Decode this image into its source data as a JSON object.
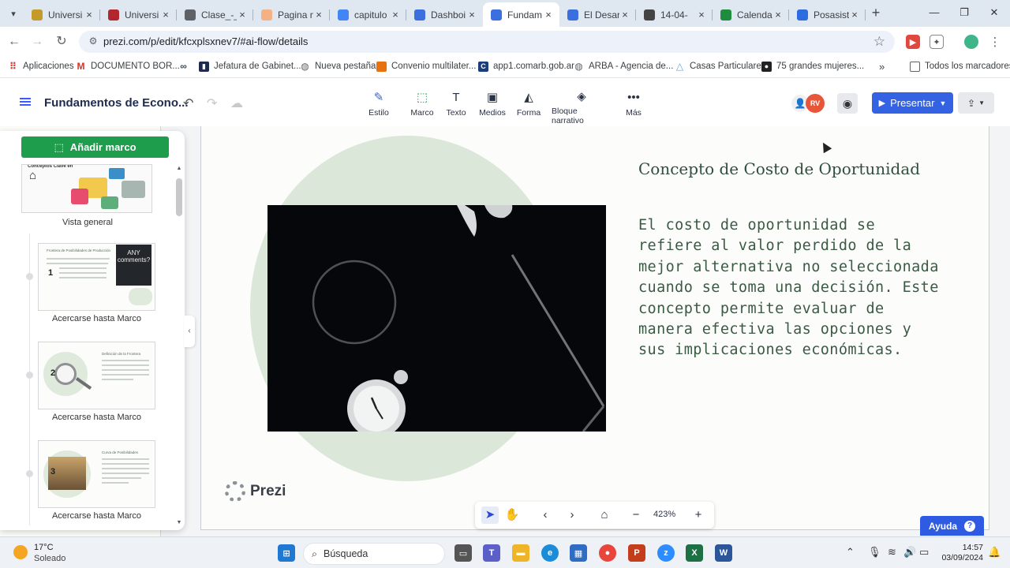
{
  "browser": {
    "tabs": [
      {
        "title": "Universi",
        "icon_color": "#c49a2b"
      },
      {
        "title": "Universi",
        "icon_color": "#b3262e"
      },
      {
        "title": "Clase_-_",
        "icon_color": "#5f6368"
      },
      {
        "title": "Pagina n",
        "icon_color": "#f4b183"
      },
      {
        "title": "capitulo",
        "icon_color": "#4285f4"
      },
      {
        "title": "Dashboi",
        "icon_color": "#3b6fe0"
      },
      {
        "title": "Fundam",
        "icon_color": "#3b6fe0"
      },
      {
        "title": "El Desar",
        "icon_color": "#3b6fe0"
      },
      {
        "title": "14-04-",
        "icon_color": "#444444"
      },
      {
        "title": "Calenda",
        "icon_color": "#1e8e3e"
      },
      {
        "title": "Posasist",
        "icon_color": "#2d6ce0"
      }
    ],
    "active_tab_index": 6,
    "url": "prezi.com/p/edit/kfcxplsxnev7/#ai-flow/details",
    "bookmarks": [
      {
        "label": "Aplicaciones",
        "color": "#e8453c"
      },
      {
        "label": "DOCUMENTO BOR...",
        "color": "#d93025"
      },
      {
        "label": "",
        "color": "#34495e"
      },
      {
        "label": "Jefatura de Gabinet...",
        "color": "#1f2b4d"
      },
      {
        "label": "Nueva pestaña",
        "color": "#5f6368"
      },
      {
        "label": "Convenio multilater...",
        "color": "#e8730e"
      },
      {
        "label": "app1.comarb.gob.ar",
        "color": "#1a3d7c"
      },
      {
        "label": "ARBA - Agencia de...",
        "color": "#5f6368"
      },
      {
        "label": "Casas Particulares",
        "color": "#6aa0d8"
      },
      {
        "label": "75 grandes mujeres...",
        "color": "#222222"
      }
    ],
    "all_bookmarks_label": "Todos los marcadores"
  },
  "app": {
    "title": "Fundamentos de Econo...",
    "tools": [
      {
        "label": "Estilo",
        "icon": "brush-icon"
      },
      {
        "label": "Marco",
        "icon": "frame-icon"
      },
      {
        "label": "Texto",
        "icon": "text-icon"
      },
      {
        "label": "Medios",
        "icon": "image-icon"
      },
      {
        "label": "Forma",
        "icon": "shape-icon"
      },
      {
        "label": "Bloque narrativo",
        "icon": "layers-icon"
      },
      {
        "label": "Más",
        "icon": "more-icon"
      }
    ],
    "avatar_initials": "RV",
    "present_label": "Presentar"
  },
  "sidebar": {
    "add_frame_label": "Añadir marco",
    "overview_label": "Vista general",
    "overview_thumb_title": "Conceptos Clave en",
    "frames": [
      {
        "number": "1",
        "label": "Acercarse hasta Marco",
        "thumb_title": "Frontera de Posibilidades de Producción",
        "thumb_badge": "ANY comments?"
      },
      {
        "number": "2",
        "label": "Acercarse hasta Marco",
        "thumb_title": "Definición de la Frontera"
      },
      {
        "number": "3",
        "label": "Acercarse hasta Marco",
        "thumb_title": "Curva de Posibilidades"
      }
    ]
  },
  "slide": {
    "heading": "Concepto de Costo de Oportunidad",
    "body": "El costo de oportunidad se refiere al valor perdido de la mejor alternativa no seleccionada cuando se toma una decisión. Este concepto permite evaluar de manera efectiva las opciones y sus implicaciones económicas.",
    "logo_text": "Prezi",
    "prev_slide_fragments": [
      "l",
      "u",
      "o",
      "a",
      "d",
      "e",
      "r"
    ]
  },
  "bottom_toolbar": {
    "zoom": "423%"
  },
  "help_label": "Ayuda",
  "taskbar": {
    "temperature": "17°C",
    "weather": "Soleado",
    "search_placeholder": "Búsqueda",
    "time": "14:57",
    "date": "03/09/2024"
  }
}
